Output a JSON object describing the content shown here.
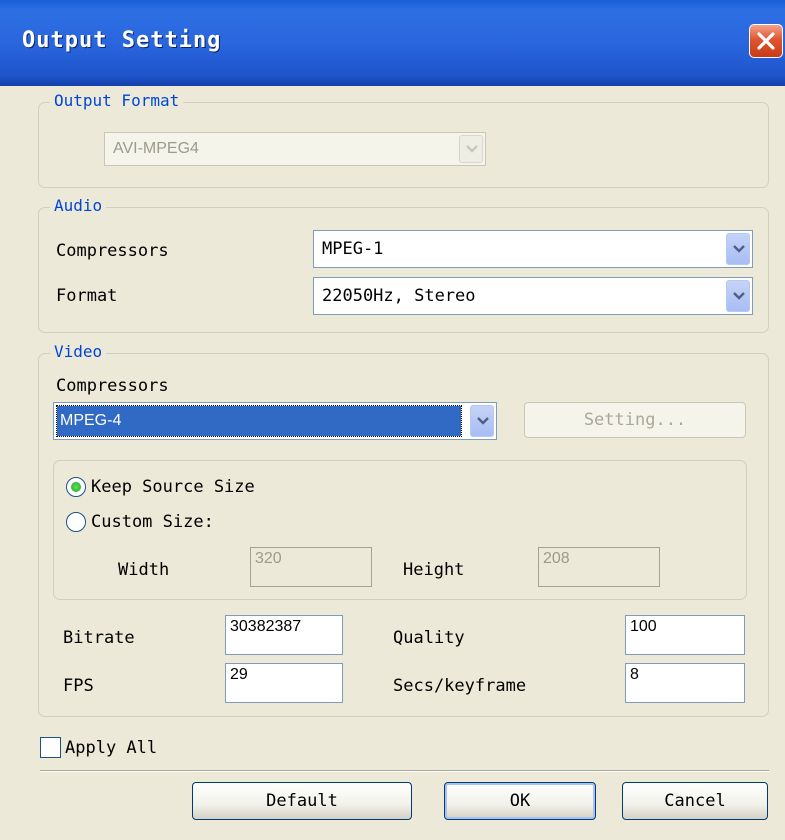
{
  "window": {
    "title": "Output Setting"
  },
  "output_format": {
    "legend": "Output Format",
    "format_value": "AVI-MPEG4"
  },
  "audio": {
    "legend": "Audio",
    "compressors_label": "Compressors",
    "compressors_value": "MPEG-1",
    "format_label": "Format",
    "format_value": "22050Hz, Stereo"
  },
  "video": {
    "legend": "Video",
    "compressors_label": "Compressors",
    "compressors_value": "MPEG-4",
    "setting_button": "Setting...",
    "keep_source_label": "Keep Source Size",
    "custom_size_label": "Custom Size:",
    "width_label": "Width",
    "width_value": "320",
    "height_label": "Height",
    "height_value": "208",
    "bitrate_label": "Bitrate",
    "bitrate_value": "30382387",
    "quality_label": "Quality",
    "quality_value": "100",
    "fps_label": "FPS",
    "fps_value": "29",
    "keyframe_label": "Secs/keyframe",
    "keyframe_value": "8",
    "size_mode": "keep_source"
  },
  "apply_all": {
    "label": "Apply All",
    "checked": false
  },
  "buttons": {
    "default": "Default",
    "ok": "OK",
    "cancel": "Cancel"
  },
  "colors": {
    "titlebar": "#2a66de",
    "legend_text": "#0046d5",
    "dialog_bg": "#ece9d8",
    "selection": "#316ac5"
  }
}
